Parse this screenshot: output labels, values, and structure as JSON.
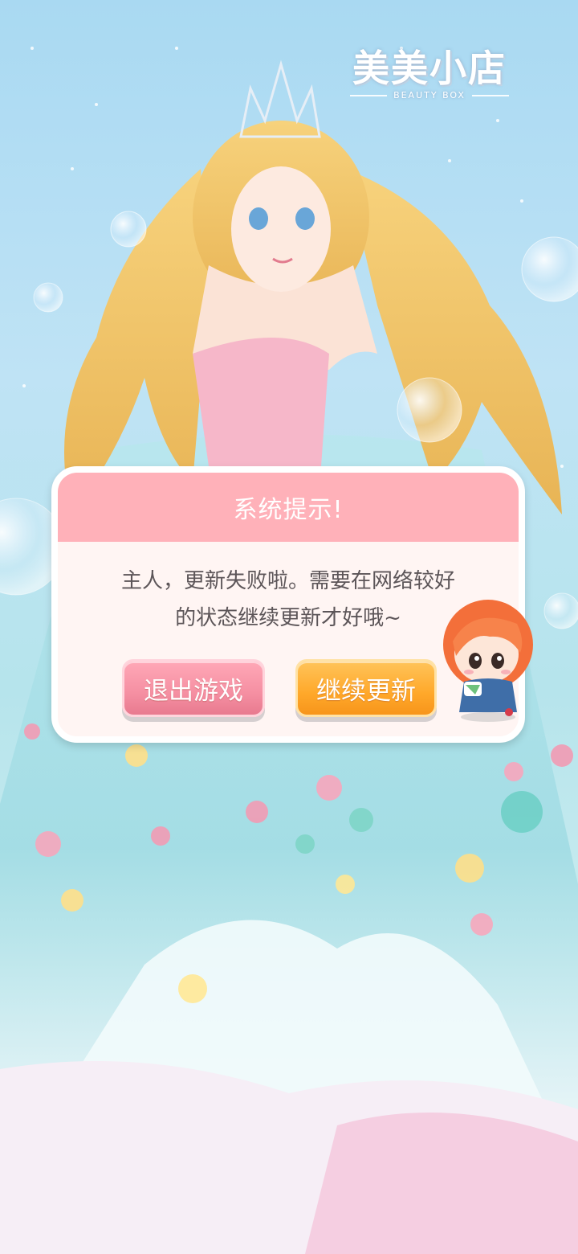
{
  "logo": {
    "title": "美美小店",
    "subtitle": "BEAUTY BOX"
  },
  "dialog": {
    "title": "系统提示!",
    "message_line1": "主人，更新失败啦。需要在网络较好",
    "message_line2": "的状态继续更新才好哦~",
    "exit_button": "退出游戏",
    "continue_button": "继续更新"
  },
  "colors": {
    "header_pink": "#ffb1b9",
    "exit_pink": "#f58fa2",
    "continue_orange": "#ffa82a",
    "text_gray": "#5c5558"
  }
}
